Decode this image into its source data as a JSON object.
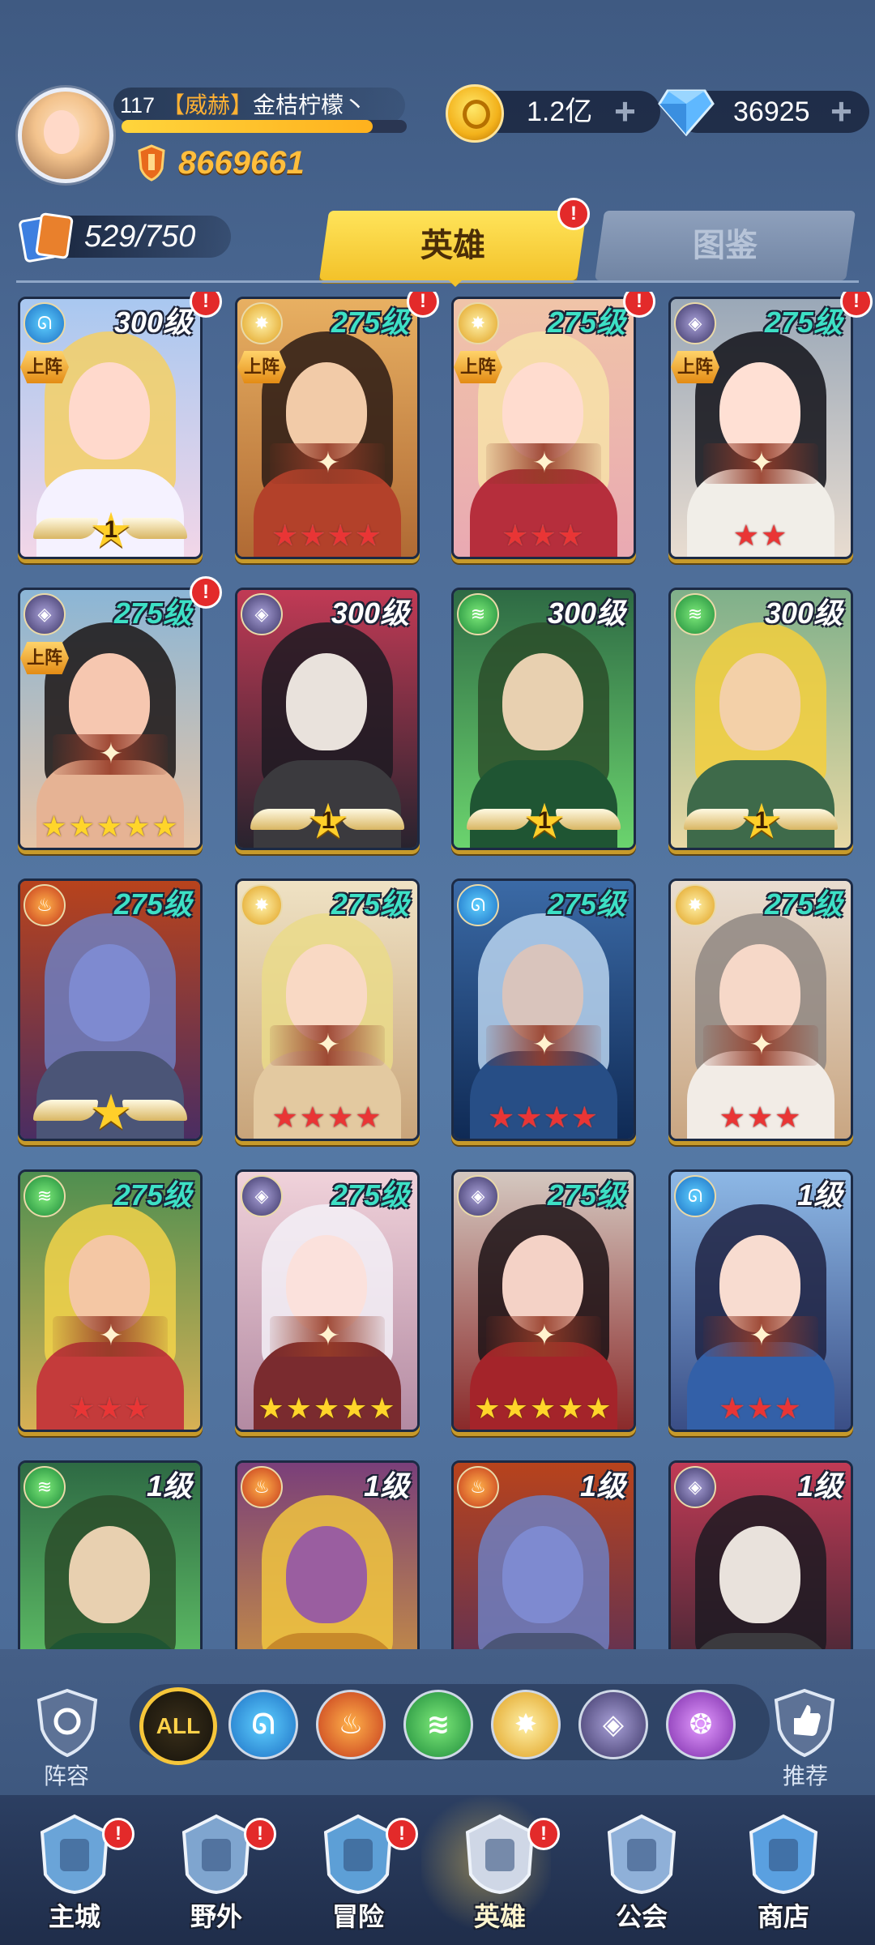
{
  "player": {
    "level": "117",
    "guild": "【威赫】",
    "name": "金桔柠檬丶",
    "power": "8669661",
    "exp_fraction": 0.88
  },
  "currency": {
    "gold": "1.2亿",
    "gems": "36925",
    "gold_icon": "gold-coin-icon",
    "gem_icon": "diamond-icon"
  },
  "hero_count": "529/750",
  "tabs": {
    "heroes": "英雄",
    "codex": "图鉴",
    "badge": "!"
  },
  "labels": {
    "on_team": "上阵",
    "formation": "阵容",
    "recommend": "推荐",
    "all": "ALL"
  },
  "colors": {
    "accent_gold": "#f3c22a",
    "level_teal": "#3de0c5",
    "badge_red": "#e32a2a"
  },
  "heroes": [
    {
      "level": "300级",
      "faction": "water",
      "on_team": true,
      "badge": true,
      "rank": "wings",
      "rank_num": "1",
      "theme": "pinkgold"
    },
    {
      "level": "275级",
      "faction": "light",
      "on_team": true,
      "badge": true,
      "rank": "stars-red",
      "stars": 4,
      "theme": "darkgold"
    },
    {
      "level": "275级",
      "faction": "light",
      "on_team": true,
      "badge": true,
      "rank": "stars-red",
      "stars": 3,
      "theme": "pinklight"
    },
    {
      "level": "275级",
      "faction": "dark",
      "on_team": true,
      "badge": true,
      "rank": "stars-red",
      "stars": 2,
      "theme": "darkhair"
    },
    {
      "level": "275级",
      "faction": "dark",
      "on_team": true,
      "badge": true,
      "rank": "stars-gold",
      "stars": 5,
      "theme": "peach"
    },
    {
      "level": "300级",
      "faction": "dark",
      "on_team": false,
      "badge": false,
      "rank": "wings",
      "rank_num": "1",
      "theme": "redskull"
    },
    {
      "level": "300级",
      "faction": "nature",
      "on_team": false,
      "badge": false,
      "rank": "wings",
      "rank_num": "1",
      "theme": "green"
    },
    {
      "level": "300级",
      "faction": "nature",
      "on_team": false,
      "badge": false,
      "rank": "wings",
      "rank_num": "1",
      "theme": "yellowhood"
    },
    {
      "level": "275级",
      "faction": "fire",
      "on_team": false,
      "badge": false,
      "rank": "wings-star",
      "rank_num": "",
      "theme": "orc"
    },
    {
      "level": "275级",
      "faction": "light",
      "on_team": false,
      "badge": false,
      "rank": "stars-red",
      "stars": 4,
      "theme": "blonde"
    },
    {
      "level": "275级",
      "faction": "water",
      "on_team": false,
      "badge": false,
      "rank": "stars-red",
      "stars": 4,
      "theme": "bluehood"
    },
    {
      "level": "275级",
      "faction": "light",
      "on_team": false,
      "badge": false,
      "rank": "stars-red",
      "stars": 3,
      "theme": "silver"
    },
    {
      "level": "275级",
      "faction": "nature",
      "on_team": false,
      "badge": false,
      "rank": "stars-red",
      "stars": 3,
      "theme": "blondered"
    },
    {
      "level": "275级",
      "faction": "dark",
      "on_team": false,
      "badge": false,
      "rank": "stars-gold",
      "stars": 5,
      "theme": "white"
    },
    {
      "level": "275级",
      "faction": "dark",
      "on_team": false,
      "badge": false,
      "rank": "stars-gold",
      "stars": 5,
      "theme": "crimson"
    },
    {
      "level": "1级",
      "faction": "water",
      "on_team": false,
      "badge": false,
      "rank": "stars-red",
      "stars": 3,
      "theme": "navy"
    },
    {
      "level": "1级",
      "faction": "nature",
      "on_team": false,
      "badge": false,
      "rank": "none",
      "theme": "green"
    },
    {
      "level": "1级",
      "faction": "fire",
      "on_team": false,
      "badge": false,
      "rank": "none",
      "theme": "purplegold"
    },
    {
      "level": "1级",
      "faction": "fire",
      "on_team": false,
      "badge": false,
      "rank": "none",
      "theme": "orc"
    },
    {
      "level": "1级",
      "faction": "dark",
      "on_team": false,
      "badge": false,
      "rank": "none",
      "theme": "redskull"
    }
  ],
  "filters": [
    {
      "key": "all",
      "icon": "all-filter-icon",
      "active": true
    },
    {
      "key": "water",
      "icon": "water-faction-icon",
      "active": false
    },
    {
      "key": "fire",
      "icon": "fire-faction-icon",
      "active": false
    },
    {
      "key": "nature",
      "icon": "nature-faction-icon",
      "active": false
    },
    {
      "key": "light",
      "icon": "light-faction-icon",
      "active": false
    },
    {
      "key": "dark",
      "icon": "dark-faction-icon",
      "active": false
    },
    {
      "key": "arcane",
      "icon": "arcane-faction-icon",
      "active": false
    }
  ],
  "nav": [
    {
      "label": "主城",
      "icon": "castle-icon",
      "badge": true,
      "active": false
    },
    {
      "label": "野外",
      "icon": "portal-icon",
      "badge": true,
      "active": false
    },
    {
      "label": "冒险",
      "icon": "trident-icon",
      "badge": true,
      "active": false
    },
    {
      "label": "英雄",
      "icon": "knight-helmet-icon",
      "badge": true,
      "active": true
    },
    {
      "label": "公会",
      "icon": "guild-banner-icon",
      "badge": false,
      "active": false
    },
    {
      "label": "商店",
      "icon": "shop-icon",
      "badge": false,
      "active": false
    }
  ]
}
